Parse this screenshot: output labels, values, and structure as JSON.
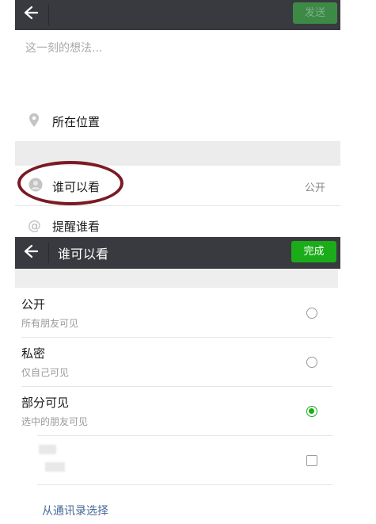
{
  "compose_screen": {
    "send_label": "发送",
    "placeholder": "这一刻的想法...",
    "location_label": "所在位置",
    "who_can_see_label": "谁可以看",
    "who_can_see_value": "公开",
    "mention_label": "提醒谁看",
    "icons": {
      "back": "back-arrow-icon",
      "location": "location-pin-icon",
      "who_can_see": "people-icon",
      "mention": "at-sign-icon"
    },
    "annotation_color": "#7a1a24"
  },
  "visibility_screen": {
    "title": "谁可以看",
    "done_label": "完成",
    "options": [
      {
        "title": "公开",
        "subtitle": "所有朋友可见",
        "selected": false
      },
      {
        "title": "私密",
        "subtitle": "仅自己可见",
        "selected": false
      },
      {
        "title": "部分可见",
        "subtitle": "选中的朋友可见",
        "selected": true
      }
    ],
    "select_from_contacts_label": "从通讯录选择",
    "accent_color": "#1aad19"
  }
}
